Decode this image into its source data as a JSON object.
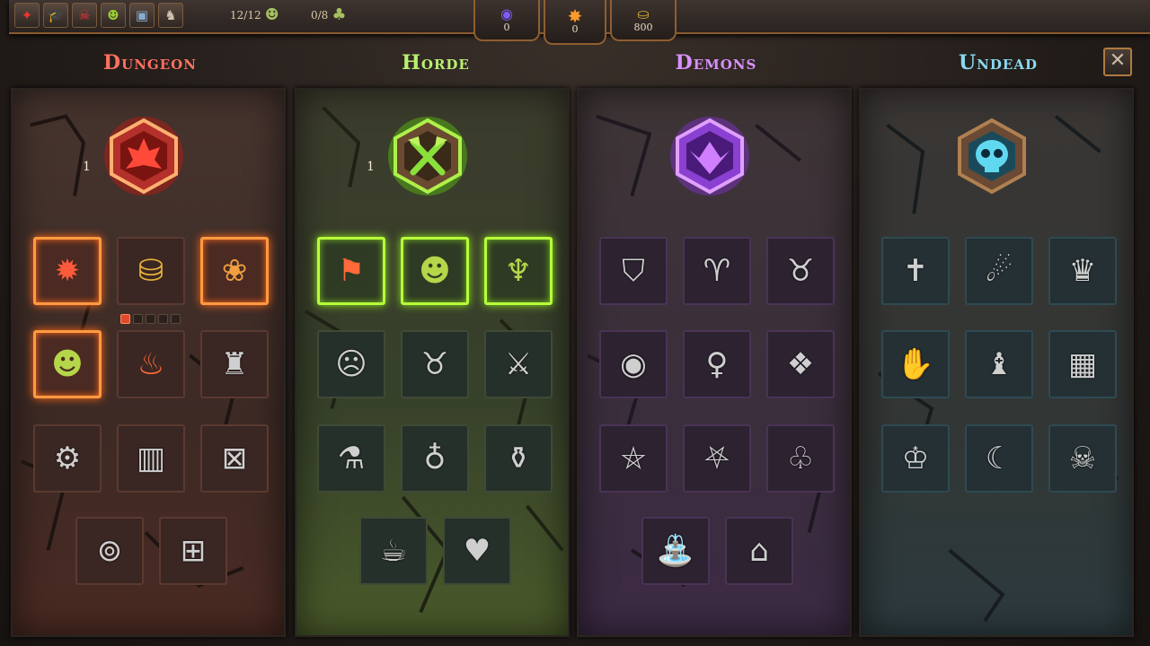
{
  "topbar": {
    "icons": [
      {
        "name": "rune-map-icon",
        "glyph": "✦",
        "tone": "red"
      },
      {
        "name": "graduation-cap-icon",
        "glyph": "🎓",
        "tone": ""
      },
      {
        "name": "demon-mask-icon",
        "glyph": "☠",
        "tone": "red"
      },
      {
        "name": "goblin-head-icon",
        "glyph": "☻",
        "tone": "green"
      },
      {
        "name": "chest-icon",
        "glyph": "▣",
        "tone": "blue"
      },
      {
        "name": "creature-icon",
        "glyph": "♞",
        "tone": ""
      }
    ],
    "minions_count": "12/12",
    "workers_count": "0/8"
  },
  "resources": {
    "gems": "0",
    "evil": "0",
    "gold": "800"
  },
  "factions": [
    {
      "title": "Dungeon",
      "level": "1"
    },
    {
      "title": "Horde",
      "level": "1"
    },
    {
      "title": "Demons",
      "level": ""
    },
    {
      "title": "Undead",
      "level": ""
    }
  ],
  "dungeon_slots": [
    {
      "name": "fire-crystal-icon",
      "glyph": "✹",
      "tone": "red",
      "active": true
    },
    {
      "name": "treasure-chest-icon",
      "glyph": "⛁",
      "tone": "gold",
      "active": false
    },
    {
      "name": "flower-idol-icon",
      "glyph": "❀",
      "tone": "multi",
      "active": true
    },
    {
      "name": "goblin-face-icon",
      "glyph": "☻",
      "tone": "grn",
      "active": true
    },
    {
      "name": "fire-throne-icon",
      "glyph": "♨",
      "tone": "org",
      "active": false
    },
    {
      "name": "tower-icon",
      "glyph": "♜",
      "tone": "gray",
      "active": false
    },
    {
      "name": "gear-cube-icon",
      "glyph": "⚙",
      "tone": "gray",
      "active": false
    },
    {
      "name": "spiked-gate-icon",
      "glyph": "▥",
      "tone": "gray",
      "active": false
    },
    {
      "name": "spike-trap-icon",
      "glyph": "⊠",
      "tone": "gray",
      "active": false
    },
    {
      "name": "bear-trap-icon",
      "glyph": "⊚",
      "tone": "gray",
      "active": false
    },
    {
      "name": "cage-trap-icon",
      "glyph": "⊞",
      "tone": "gray",
      "active": false
    }
  ],
  "horde_slots": [
    {
      "name": "orc-banner-icon",
      "glyph": "⚑",
      "tone": "org",
      "active": true
    },
    {
      "name": "orc-face-icon",
      "glyph": "☻",
      "tone": "grn",
      "active": true
    },
    {
      "name": "dragon-head-icon",
      "glyph": "♆",
      "tone": "grn",
      "active": true
    },
    {
      "name": "goblin-head-icon",
      "glyph": "☹",
      "tone": "gray",
      "active": false
    },
    {
      "name": "beast-goggles-icon",
      "glyph": "♉",
      "tone": "gray",
      "active": false
    },
    {
      "name": "crossed-swords-icon",
      "glyph": "⚔",
      "tone": "gray",
      "active": false
    },
    {
      "name": "potion-flask-icon",
      "glyph": "⚗",
      "tone": "gray",
      "active": false
    },
    {
      "name": "potion-bottle-icon",
      "glyph": "♁",
      "tone": "gray",
      "active": false
    },
    {
      "name": "chained-flask-icon",
      "glyph": "⚱",
      "tone": "gray",
      "active": false
    },
    {
      "name": "beer-mug-icon",
      "glyph": "☕",
      "tone": "gray",
      "active": false
    },
    {
      "name": "heart-relic-icon",
      "glyph": "♥",
      "tone": "gray",
      "active": false
    }
  ],
  "demons_slots": [
    {
      "name": "pentagram-shield-icon",
      "glyph": "⛉",
      "tone": "gray",
      "active": false
    },
    {
      "name": "horned-demon-icon",
      "glyph": "♈",
      "tone": "gray",
      "active": false
    },
    {
      "name": "dark-horns-icon",
      "glyph": "♉",
      "tone": "gray",
      "active": false
    },
    {
      "name": "demon-globe-icon",
      "glyph": "◉",
      "tone": "gray",
      "active": false
    },
    {
      "name": "succubus-icon",
      "glyph": "♀",
      "tone": "gray",
      "active": false
    },
    {
      "name": "crystal-orbs-icon",
      "glyph": "❖",
      "tone": "gray",
      "active": false
    },
    {
      "name": "pentagram-icon",
      "glyph": "⛤",
      "tone": "gray",
      "active": false
    },
    {
      "name": "pentagram-circle-icon",
      "glyph": "⛧",
      "tone": "gray",
      "active": false
    },
    {
      "name": "rubber-duck-icon",
      "glyph": "♧",
      "tone": "gray",
      "active": false
    },
    {
      "name": "fountain-icon",
      "glyph": "⛲",
      "tone": "gray",
      "active": false
    },
    {
      "name": "gargoyle-door-icon",
      "glyph": "⌂",
      "tone": "gray",
      "active": false
    }
  ],
  "undead_slots": [
    {
      "name": "tombstone-icon",
      "glyph": "✝",
      "tone": "gray",
      "active": false
    },
    {
      "name": "banshee-icon",
      "glyph": "☄",
      "tone": "gray",
      "active": false
    },
    {
      "name": "skull-crown-icon",
      "glyph": "♛",
      "tone": "gray",
      "active": false
    },
    {
      "name": "spectral-hand-icon",
      "glyph": "✋",
      "tone": "gray",
      "active": false
    },
    {
      "name": "vampire-icon",
      "glyph": "♝",
      "tone": "gray",
      "active": false
    },
    {
      "name": "skull-cage-icon",
      "glyph": "▦",
      "tone": "gray",
      "active": false
    },
    {
      "name": "bone-throne-icon",
      "glyph": "♔",
      "tone": "gray",
      "active": false
    },
    {
      "name": "reaper-blade-icon",
      "glyph": "☾",
      "tone": "gray",
      "active": false
    },
    {
      "name": "skull-block-icon",
      "glyph": "☠",
      "tone": "gray",
      "active": false
    }
  ],
  "dungeon_dots": [
    true,
    false,
    false,
    false,
    false
  ],
  "colors": {
    "dungeon": "#ff7060",
    "horde": "#b8f070",
    "demons": "#d890ff",
    "undead": "#8ad8f0"
  }
}
